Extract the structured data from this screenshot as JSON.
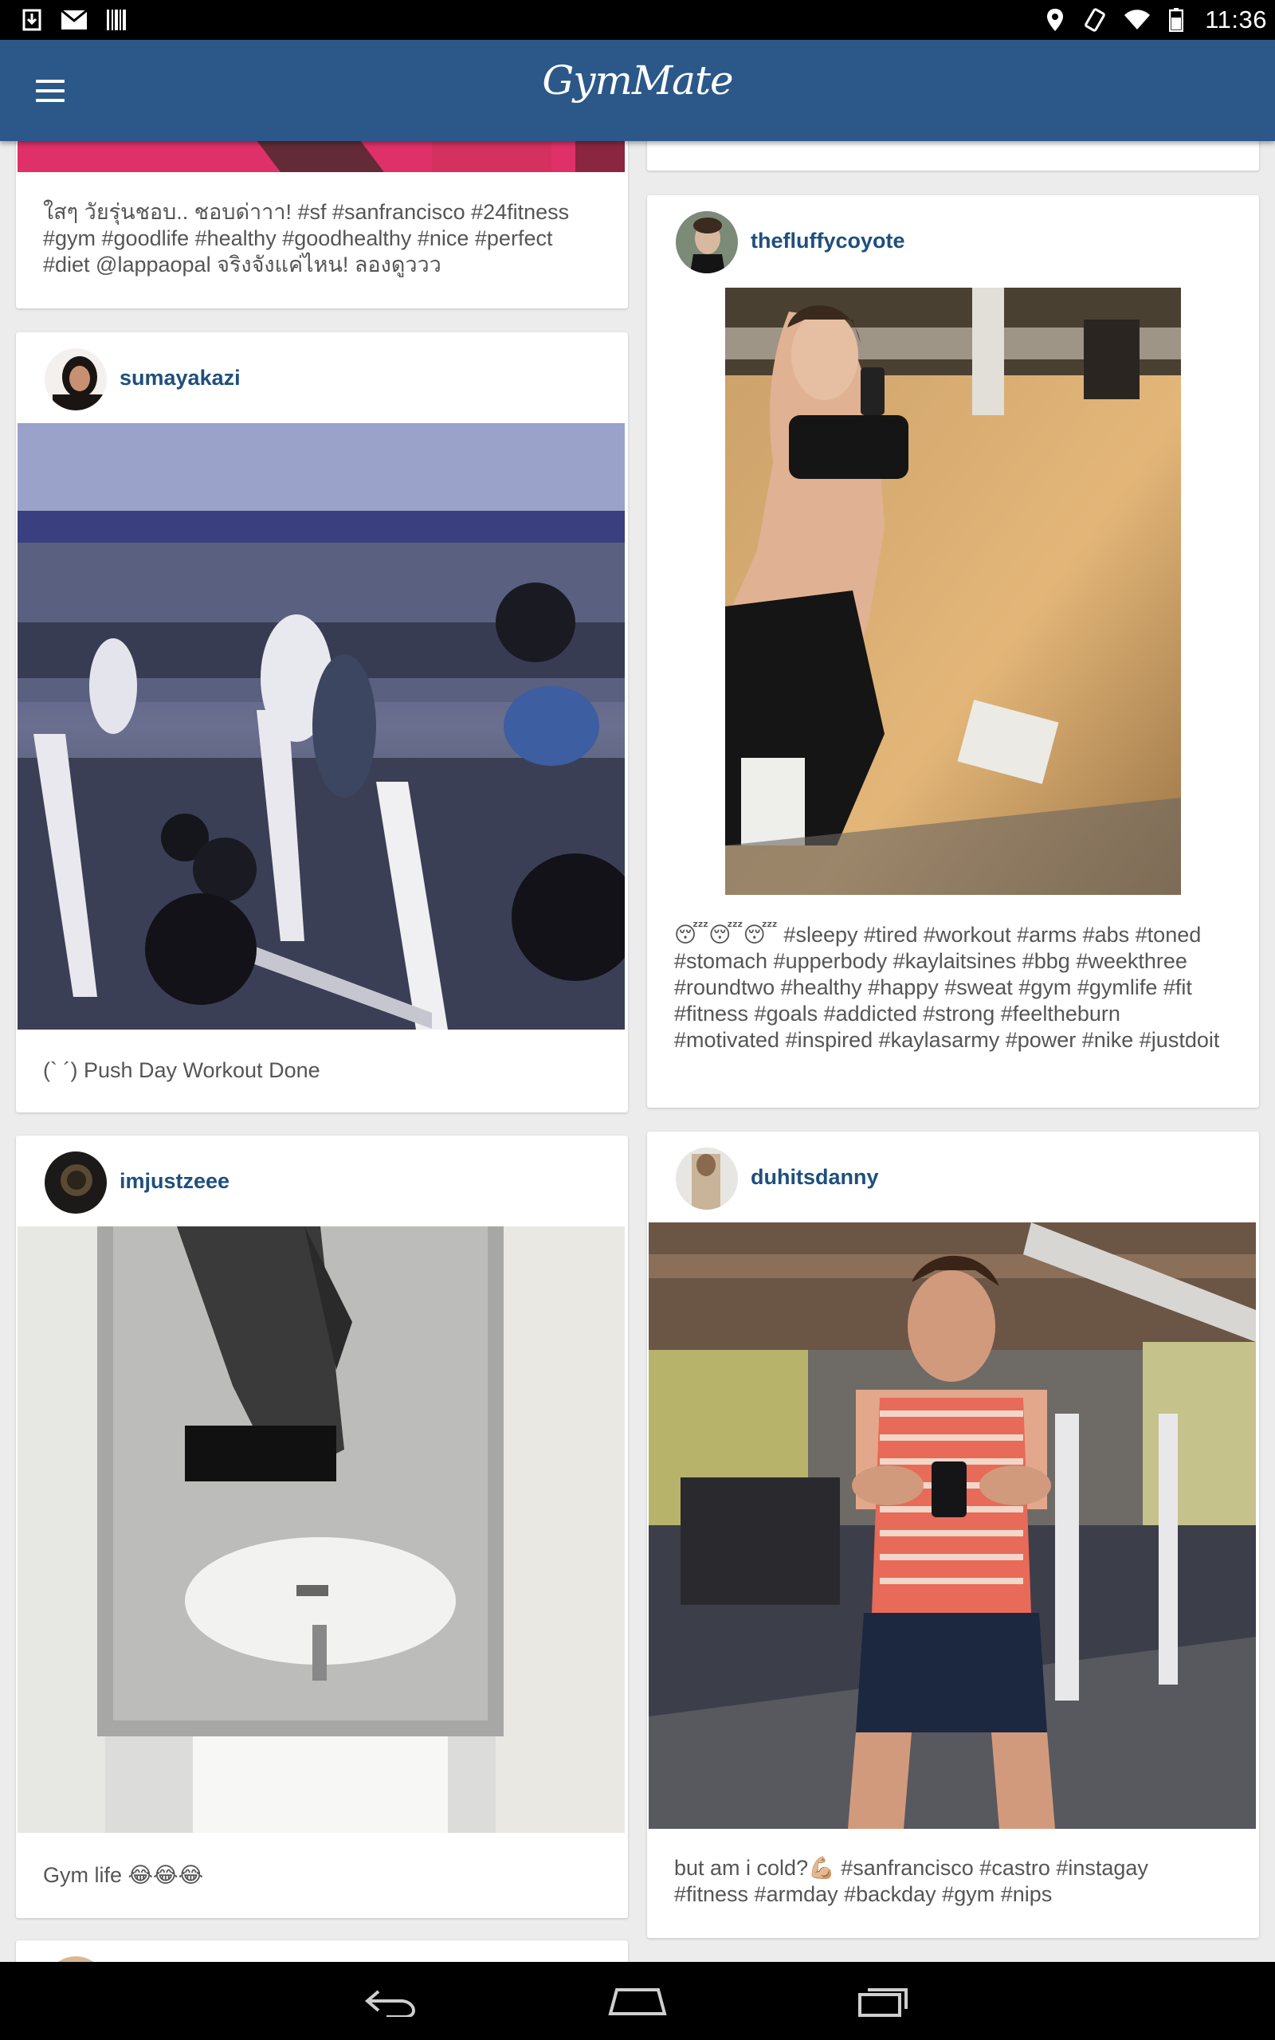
{
  "status_bar": {
    "time": "11:36",
    "left_icons": [
      "download-icon",
      "gmail-icon",
      "barcode-icon"
    ],
    "right_icons": [
      "location-icon",
      "rotate-icon",
      "wifi-icon",
      "battery-icon"
    ]
  },
  "app_bar": {
    "title": "GymMate",
    "menu_icon": "hamburger-menu-icon",
    "color": "#2b5889"
  },
  "feed": {
    "posts": [
      {
        "username": "",
        "caption": "ใสๆ วัยรุ่นชอบ.. ชอบด่าาา! #sf #sanfrancisco #24fitness #gym #goodlife #healthy #goodhealthy #nice #perfect #diet @lappaopal จริงจังแค่ไหน! ลองดูววว"
      },
      {
        "username": "sumayakazi",
        "caption": "(` ´) Push Day Workout Done"
      },
      {
        "username": "imjustzeee",
        "caption": "Gym life 😂😂😂"
      },
      {
        "username": "thefluffycoyote",
        "caption": "😴😴😴 #sleepy #tired #workout #arms #abs #toned #stomach #upperbody #kaylaitsines #bbg #weekthree #roundtwo #healthy #happy #sweat #gym #gymlife #fit #fitness #goals #addicted #strong #feeltheburn #motivated #inspired #kaylasarmy #power #nike #justdoit"
      },
      {
        "username": "duhitsdanny",
        "caption": "but am i cold?💪🏼 #sanfrancisco #castro #instagay #fitness #armday #backday #gym #nips"
      }
    ]
  },
  "nav_bar": {
    "buttons": [
      "back-icon",
      "home-icon",
      "recents-icon"
    ]
  }
}
